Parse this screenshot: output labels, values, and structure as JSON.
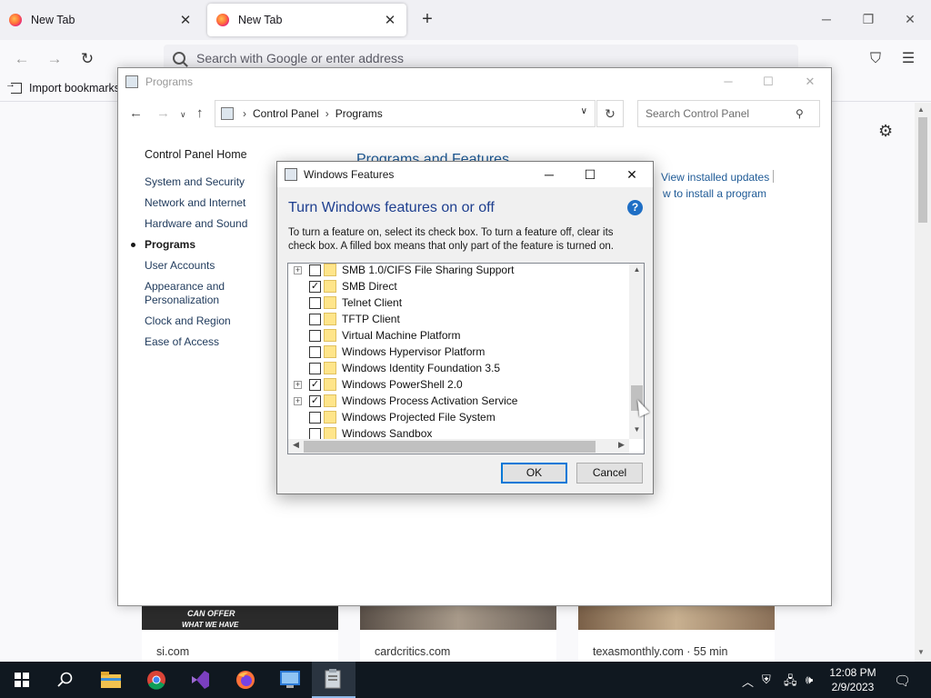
{
  "browser": {
    "tabs": [
      {
        "label": "New Tab"
      },
      {
        "label": "New Tab"
      }
    ],
    "urlbar": {
      "placeholder": "Search with Google or enter address"
    },
    "bookmarks": {
      "import_label": "Import bookmarks..."
    },
    "shortcuts": [
      {
        "label": "si.com"
      },
      {
        "label": "cardcritics.com"
      },
      {
        "label": "texasmonthly.com · 55 min"
      }
    ],
    "thumb_text": [
      "CAN OFFER",
      "WHAT WE HAVE"
    ]
  },
  "control_panel": {
    "title": "Programs",
    "breadcrumb": [
      "Control Panel",
      "Programs"
    ],
    "search_placeholder": "Search Control Panel",
    "sidebar": {
      "home": "Control Panel Home",
      "items": [
        {
          "label": "System and Security"
        },
        {
          "label": "Network and Internet"
        },
        {
          "label": "Hardware and Sound"
        },
        {
          "label": "Programs"
        },
        {
          "label": "User Accounts"
        },
        {
          "label": "Appearance and Personalization"
        },
        {
          "label": "Clock and Region"
        },
        {
          "label": "Ease of Access"
        }
      ]
    },
    "section_title": "Programs and Features",
    "links": [
      "View installed updates",
      "w to install a program"
    ]
  },
  "windows_features": {
    "title": "Windows Features",
    "heading": "Turn Windows features on or off",
    "description": "To turn a feature on, select its check box. To turn a feature off, clear its check box. A filled box means that only part of the feature is turned on.",
    "features": [
      {
        "label": "SMB 1.0/CIFS File Sharing Support",
        "expandable": true,
        "checked": false
      },
      {
        "label": "SMB Direct",
        "expandable": false,
        "checked": true
      },
      {
        "label": "Telnet Client",
        "expandable": false,
        "checked": false
      },
      {
        "label": "TFTP Client",
        "expandable": false,
        "checked": false
      },
      {
        "label": "Virtual Machine Platform",
        "expandable": false,
        "checked": false
      },
      {
        "label": "Windows Hypervisor Platform",
        "expandable": false,
        "checked": false
      },
      {
        "label": "Windows Identity Foundation 3.5",
        "expandable": false,
        "checked": false
      },
      {
        "label": "Windows PowerShell 2.0",
        "expandable": true,
        "checked": true
      },
      {
        "label": "Windows Process Activation Service",
        "expandable": true,
        "checked": true
      },
      {
        "label": "Windows Projected File System",
        "expandable": false,
        "checked": false
      },
      {
        "label": "Windows Sandbox",
        "expandable": false,
        "checked": false
      }
    ],
    "ok_label": "OK",
    "cancel_label": "Cancel"
  },
  "taskbar": {
    "apps": [
      "start-icon",
      "search-icon",
      "file-explorer-icon",
      "chrome-icon",
      "visual-studio-icon",
      "firefox-icon",
      "control-panel-icon",
      "windows-features-icon"
    ],
    "time": "12:08 PM",
    "date": "2/9/2023"
  }
}
